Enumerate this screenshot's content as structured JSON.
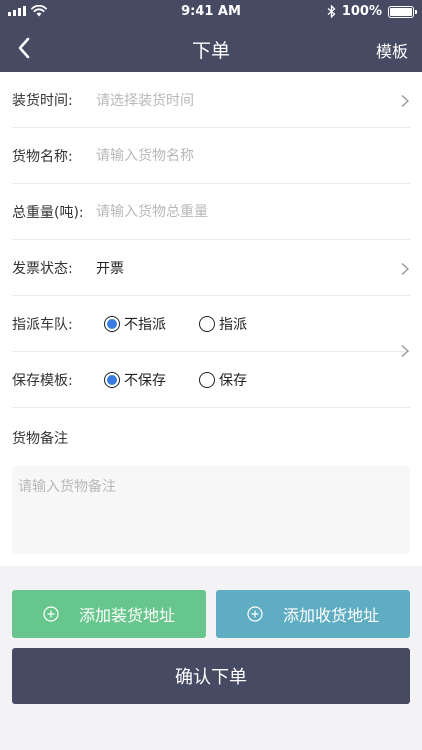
{
  "status_bar": {
    "time": "9:41 AM",
    "battery": "100%"
  },
  "nav": {
    "title": "下单",
    "template_label": "模板"
  },
  "form": {
    "load_time": {
      "label": "装货时间:",
      "placeholder": "请选择装货时间"
    },
    "goods_name": {
      "label": "货物名称:",
      "placeholder": "请输入货物名称"
    },
    "total_weight": {
      "label": "总重量(吨):",
      "placeholder": "请输入货物总重量"
    },
    "invoice": {
      "label": "发票状态:",
      "value": "开票"
    },
    "assign_fleet": {
      "label": "指派车队:",
      "options": [
        {
          "label": "不指派",
          "checked": true
        },
        {
          "label": "指派",
          "checked": false
        }
      ]
    },
    "save_template": {
      "label": "保存模板:",
      "options": [
        {
          "label": "不保存",
          "checked": true
        },
        {
          "label": "保存",
          "checked": false
        }
      ]
    },
    "remark": {
      "label": "货物备注",
      "placeholder": "请输入货物备注"
    }
  },
  "actions": {
    "add_load_address": "添加装货地址",
    "add_unload_address": "添加收货地址",
    "confirm": "确认下单"
  },
  "colors": {
    "header": "#474a63",
    "add_load": "#66c68b",
    "add_unload": "#5fadc2",
    "confirm": "#474a63",
    "radio_checked": "#3a7be0"
  }
}
